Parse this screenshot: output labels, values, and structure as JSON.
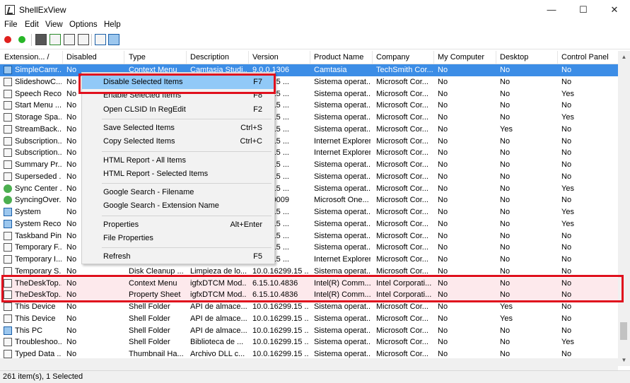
{
  "window": {
    "title": "ShellExView",
    "min_glyph": "—",
    "max_glyph": "☐",
    "close_glyph": "✕"
  },
  "menu": [
    "File",
    "Edit",
    "View",
    "Options",
    "Help"
  ],
  "toolbar_icons": [
    "red-circle-icon",
    "green-circle-icon",
    "save-icon",
    "refresh-icon",
    "copy-icon",
    "properties-icon",
    "find-icon",
    "exit-icon"
  ],
  "columns": [
    "Extension... /",
    "Disabled",
    "Type",
    "Description",
    "Version",
    "Product Name",
    "Company",
    "My Computer",
    "Desktop",
    "Control Panel"
  ],
  "rows": [
    {
      "name": "SimpleCamr...",
      "disabled": "No",
      "type": "Context Menu",
      "desc": "Camtasia Studi...",
      "version": "9.0.0.1306",
      "product": "Camtasia",
      "company": "TechSmith Cor...",
      "mycomp": "No",
      "desktop": "No",
      "cp": "No",
      "icon": "blue",
      "state": "selected"
    },
    {
      "name": "SlideshowC...",
      "disabled": "No",
      "type": "",
      "desc": "",
      "version": "6299.15 ...",
      "product": "Sistema operat...",
      "company": "Microsoft Cor...",
      "mycomp": "No",
      "desktop": "No",
      "cp": "No",
      "icon": "doc",
      "state": ""
    },
    {
      "name": "Speech Reco...",
      "disabled": "No",
      "type": "",
      "desc": "",
      "version": "6299.15 ...",
      "product": "Sistema operat...",
      "company": "Microsoft Cor...",
      "mycomp": "No",
      "desktop": "No",
      "cp": "Yes",
      "icon": "doc",
      "state": ""
    },
    {
      "name": "Start Menu ...",
      "disabled": "No",
      "type": "",
      "desc": "",
      "version": "6299.15 ...",
      "product": "Sistema operat...",
      "company": "Microsoft Cor...",
      "mycomp": "No",
      "desktop": "No",
      "cp": "No",
      "icon": "doc",
      "state": ""
    },
    {
      "name": "Storage Spa...",
      "disabled": "No",
      "type": "",
      "desc": "",
      "version": "6299.15 ...",
      "product": "Sistema operat...",
      "company": "Microsoft Cor...",
      "mycomp": "No",
      "desktop": "No",
      "cp": "Yes",
      "icon": "doc",
      "state": ""
    },
    {
      "name": "StreamBack...",
      "disabled": "No",
      "type": "",
      "desc": "",
      "version": "6299.15 ...",
      "product": "Sistema operat...",
      "company": "Microsoft Cor...",
      "mycomp": "No",
      "desktop": "Yes",
      "cp": "No",
      "icon": "doc",
      "state": ""
    },
    {
      "name": "Subscription...",
      "disabled": "No",
      "type": "",
      "desc": "",
      "version": "6299.15 ...",
      "product": "Internet Explorer",
      "company": "Microsoft Cor...",
      "mycomp": "No",
      "desktop": "No",
      "cp": "No",
      "icon": "doc",
      "state": ""
    },
    {
      "name": "Subscription...",
      "disabled": "No",
      "type": "",
      "desc": "",
      "version": "6299.15 ...",
      "product": "Internet Explorer",
      "company": "Microsoft Cor...",
      "mycomp": "No",
      "desktop": "No",
      "cp": "No",
      "icon": "doc",
      "state": ""
    },
    {
      "name": "Summary Pr...",
      "disabled": "No",
      "type": "",
      "desc": "",
      "version": "6299.15 ...",
      "product": "Sistema operat...",
      "company": "Microsoft Cor...",
      "mycomp": "No",
      "desktop": "No",
      "cp": "No",
      "icon": "doc",
      "state": ""
    },
    {
      "name": "Superseded ...",
      "disabled": "No",
      "type": "",
      "desc": "",
      "version": "6299.15 ...",
      "product": "Sistema operat...",
      "company": "Microsoft Cor...",
      "mycomp": "No",
      "desktop": "No",
      "cp": "No",
      "icon": "doc",
      "state": ""
    },
    {
      "name": "Sync Center ...",
      "disabled": "No",
      "type": "",
      "desc": "",
      "version": "6299.15 ...",
      "product": "Sistema operat...",
      "company": "Microsoft Cor...",
      "mycomp": "No",
      "desktop": "No",
      "cp": "Yes",
      "icon": "green",
      "state": ""
    },
    {
      "name": "SyncingOver...",
      "disabled": "No",
      "type": "",
      "desc": "",
      "version": "0204.0009",
      "product": "Microsoft One...",
      "company": "Microsoft Cor...",
      "mycomp": "No",
      "desktop": "No",
      "cp": "No",
      "icon": "green",
      "state": ""
    },
    {
      "name": "System",
      "disabled": "No",
      "type": "",
      "desc": "",
      "version": "6299.15 ...",
      "product": "Sistema operat...",
      "company": "Microsoft Cor...",
      "mycomp": "No",
      "desktop": "No",
      "cp": "Yes",
      "icon": "blue",
      "state": ""
    },
    {
      "name": "System Reco...",
      "disabled": "No",
      "type": "",
      "desc": "",
      "version": "6299.15 ...",
      "product": "Sistema operat...",
      "company": "Microsoft Cor...",
      "mycomp": "No",
      "desktop": "No",
      "cp": "Yes",
      "icon": "blue",
      "state": ""
    },
    {
      "name": "Taskband Pin",
      "disabled": "No",
      "type": "",
      "desc": "",
      "version": "6299.15 ...",
      "product": "Sistema operat...",
      "company": "Microsoft Cor...",
      "mycomp": "No",
      "desktop": "No",
      "cp": "No",
      "icon": "doc",
      "state": ""
    },
    {
      "name": "Temporary F...",
      "disabled": "No",
      "type": "",
      "desc": "",
      "version": "6299.15 ...",
      "product": "Sistema operat...",
      "company": "Microsoft Cor...",
      "mycomp": "No",
      "desktop": "No",
      "cp": "No",
      "icon": "doc",
      "state": ""
    },
    {
      "name": "Temporary I...",
      "disabled": "No",
      "type": "",
      "desc": "",
      "version": "6299.15 ...",
      "product": "Internet Explorer",
      "company": "Microsoft Cor...",
      "mycomp": "No",
      "desktop": "No",
      "cp": "No",
      "icon": "doc",
      "state": ""
    },
    {
      "name": "Temporary S...",
      "disabled": "No",
      "type": "Disk Cleanup ...",
      "desc": "Limpieza de lo...",
      "version": "10.0.16299.15 ...",
      "product": "Sistema operat...",
      "company": "Microsoft Cor...",
      "mycomp": "No",
      "desktop": "No",
      "cp": "No",
      "icon": "doc",
      "state": ""
    },
    {
      "name": "TheDeskTop...",
      "disabled": "No",
      "type": "Context Menu",
      "desc": "igfxDTCM Mod...",
      "version": "6.15.10.4836",
      "product": "Intel(R) Comm...",
      "company": "Intel Corporati...",
      "mycomp": "No",
      "desktop": "No",
      "cp": "No",
      "icon": "doc",
      "state": "pink"
    },
    {
      "name": "TheDeskTop...",
      "disabled": "No",
      "type": "Property Sheet",
      "desc": "igfxDTCM Mod...",
      "version": "6.15.10.4836",
      "product": "Intel(R) Comm...",
      "company": "Intel Corporati...",
      "mycomp": "No",
      "desktop": "No",
      "cp": "No",
      "icon": "doc",
      "state": "pink"
    },
    {
      "name": "This Device",
      "disabled": "No",
      "type": "Shell Folder",
      "desc": "API de almace...",
      "version": "10.0.16299.15 ...",
      "product": "Sistema operat...",
      "company": "Microsoft Cor...",
      "mycomp": "No",
      "desktop": "Yes",
      "cp": "No",
      "icon": "doc",
      "state": ""
    },
    {
      "name": "This Device",
      "disabled": "No",
      "type": "Shell Folder",
      "desc": "API de almace...",
      "version": "10.0.16299.15 ...",
      "product": "Sistema operat...",
      "company": "Microsoft Cor...",
      "mycomp": "No",
      "desktop": "Yes",
      "cp": "No",
      "icon": "doc",
      "state": ""
    },
    {
      "name": "This PC",
      "disabled": "No",
      "type": "Shell Folder",
      "desc": "API de almace...",
      "version": "10.0.16299.15 ...",
      "product": "Sistema operat...",
      "company": "Microsoft Cor...",
      "mycomp": "No",
      "desktop": "No",
      "cp": "No",
      "icon": "blue",
      "state": ""
    },
    {
      "name": "Troubleshoo...",
      "disabled": "No",
      "type": "Shell Folder",
      "desc": "Biblioteca de ...",
      "version": "10.0.16299.15 ...",
      "product": "Sistema operat...",
      "company": "Microsoft Cor...",
      "mycomp": "No",
      "desktop": "No",
      "cp": "Yes",
      "icon": "doc",
      "state": ""
    },
    {
      "name": "Typed Data ...",
      "disabled": "No",
      "type": "Thumbnail Ha...",
      "desc": "Archivo DLL c...",
      "version": "10.0.16299.15 ...",
      "product": "Sistema operat...",
      "company": "Microsoft Cor...",
      "mycomp": "No",
      "desktop": "No",
      "cp": "No",
      "icon": "doc",
      "state": ""
    }
  ],
  "context_menu": {
    "items": [
      {
        "label": "Disable Selected Items",
        "key": "F7",
        "highlight": true
      },
      {
        "label": "Enable Selected Items",
        "key": "F8"
      },
      {
        "label": "Open CLSID In RegEdit",
        "key": "F2"
      },
      {
        "sep": true
      },
      {
        "label": "Save Selected Items",
        "key": "Ctrl+S"
      },
      {
        "label": "Copy Selected Items",
        "key": "Ctrl+C"
      },
      {
        "sep": true
      },
      {
        "label": "HTML Report - All Items",
        "key": ""
      },
      {
        "label": "HTML Report - Selected Items",
        "key": ""
      },
      {
        "sep": true
      },
      {
        "label": "Google Search - Filename",
        "key": ""
      },
      {
        "label": "Google Search - Extension Name",
        "key": ""
      },
      {
        "sep": true
      },
      {
        "label": "Properties",
        "key": "Alt+Enter"
      },
      {
        "label": "File Properties",
        "key": ""
      },
      {
        "sep": true
      },
      {
        "label": "Refresh",
        "key": "F5"
      }
    ]
  },
  "status": {
    "text": "261 item(s), 1 Selected"
  },
  "colors": {
    "selected": "#3c8de6",
    "highlight": "#91c9f7",
    "annotation": "#e0101d",
    "pink_row": "#fde9ec"
  }
}
